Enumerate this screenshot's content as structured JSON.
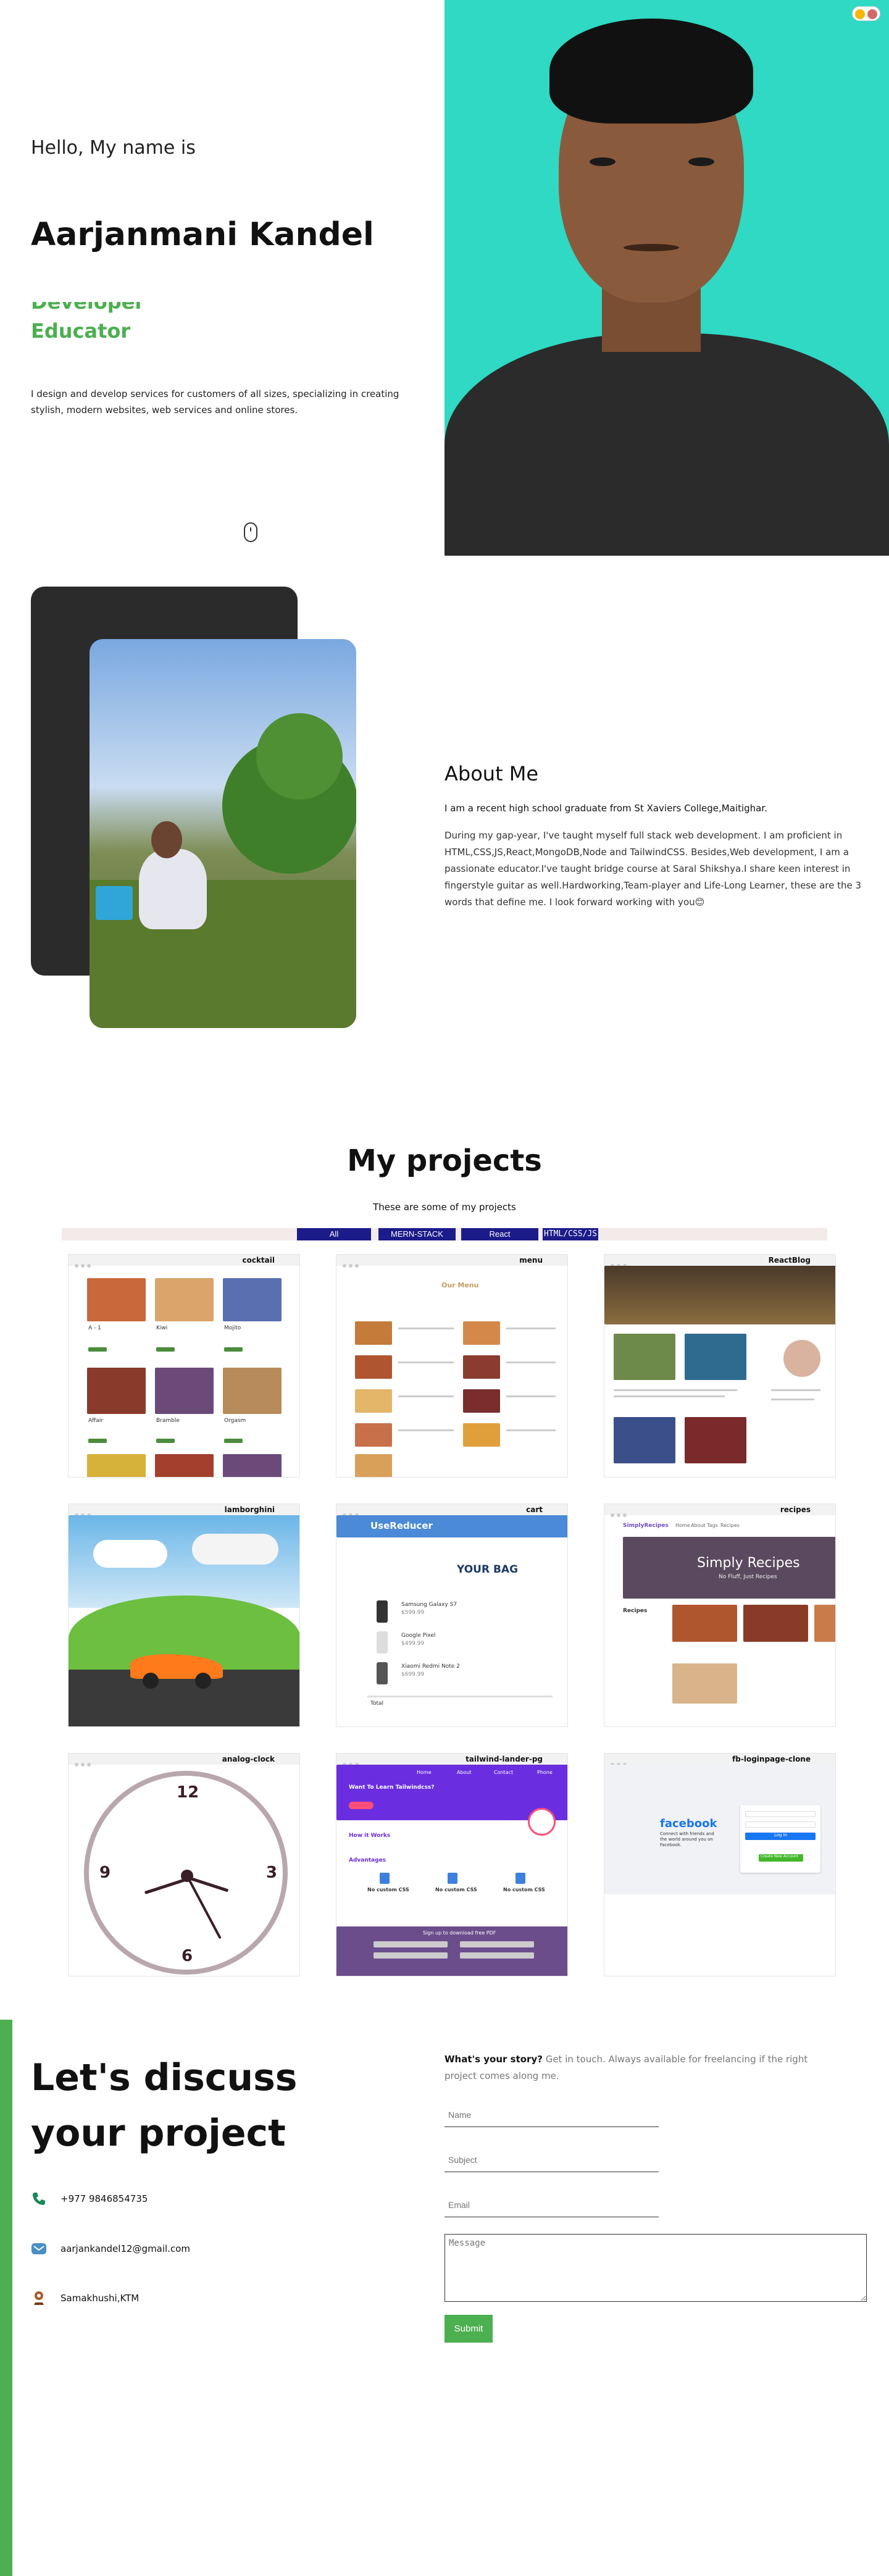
{
  "hero": {
    "greeting": "Hello, My name is",
    "name": "Aarjanmani Kandel",
    "role_ghost": "Developer",
    "role": "Educator",
    "description": "I design and develop services for customers of all sizes, specializing in creating stylish, modern websites, web services and online stores."
  },
  "about": {
    "title": "About Me",
    "lead": "I am a recent high school graduate from St Xaviers College,Maitighar.",
    "body": "During my gap-year, I've taught myself full stack web development. I am proficient in HTML,CSS,JS,React,MongoDB,Node and TailwindCSS. Besides,Web development, I am a passionate educator.I've taught bridge course at Saral Shikshya.I share keen interest in fingerstyle guitar as well.Hardworking,Team-player and Life-Long Learner, these are the 3 words that define me. I look forward working with you😊"
  },
  "projects": {
    "title": "My projects",
    "subtitle": "These are some of my projects",
    "filters": [
      "All",
      "MERN-STACK",
      "React",
      "HTML/CSS/JS"
    ],
    "cards": [
      {
        "title": "cocktail"
      },
      {
        "title": "menu"
      },
      {
        "title": "ReactBlog"
      },
      {
        "title": "lamborghini"
      },
      {
        "title": "cart"
      },
      {
        "title": "recipes"
      },
      {
        "title": "analog-clock"
      },
      {
        "title": "tailwind-lander-pg"
      },
      {
        "title": "fb-loginpage-clone"
      }
    ],
    "thumb_text": {
      "menu_heading": "Our Menu",
      "cart_header": "UseReducer",
      "cart_bag": "YOUR BAG",
      "cart_items": [
        "Samsung Galaxy S7",
        "Google Pixel",
        "Xiaomi Redmi Note 2"
      ],
      "cart_prices": [
        "$599.99",
        "$499.99",
        "$699.99"
      ],
      "cart_total": "Total",
      "recipes_logo": "SimplyRecipes",
      "recipes_banner": "Simply Recipes",
      "recipes_banner_sub": "No Fluff, Just Recipes",
      "recipes_side": "Recipes",
      "recipes_nav": [
        "Home",
        "About",
        "Tags",
        "Recipes"
      ],
      "tailwind_heading": "Want To Learn Tailwindcss?",
      "tailwind_section": "How it Works",
      "tailwind_adv": "Advantages",
      "tailwind_cards": [
        "No custom CSS",
        "No custom CSS",
        "No custom CSS"
      ],
      "tailwind_footer": "Sign up to download free PDF",
      "tailwind_nav": [
        "Home",
        "About",
        "Contact",
        "Phone"
      ],
      "fb_logo": "facebook",
      "fb_tag": "Connect with friends and the world around you on Facebook.",
      "fb_login": "Log In",
      "fb_create": "Create New Account",
      "cocktail_names": [
        "A - 1",
        "Kiwi",
        "Mojito",
        "Affair",
        "Bramble",
        "Orgasm"
      ],
      "clock_numbers": [
        "12",
        "3",
        "6",
        "9"
      ]
    }
  },
  "contact": {
    "title": "Let's discuss your project",
    "lead_strong": "What's your story?",
    "lead_rest": " Get in touch. Always available for freelancing if the right project comes along me.",
    "phone": "+977 9846854735",
    "email": "aarjankandel12@gmail.com",
    "location": "Samakhushi,KTM",
    "form": {
      "name_placeholder": "Name",
      "subject_placeholder": "Subject",
      "email_placeholder": "Email",
      "message_placeholder": "Message",
      "submit_label": "Submit"
    }
  },
  "colors": {
    "accent_green": "#4caf50",
    "hero_bg_teal": "#2fd9c3",
    "dark_card": "#2b2b2b",
    "filter_blue": "#1b1b8a"
  },
  "icons": {
    "scroll": "mouse-icon",
    "phone": "phone-icon",
    "email": "mail-icon",
    "location": "map-pin-icon",
    "theme": "theme-toggle-icon"
  }
}
